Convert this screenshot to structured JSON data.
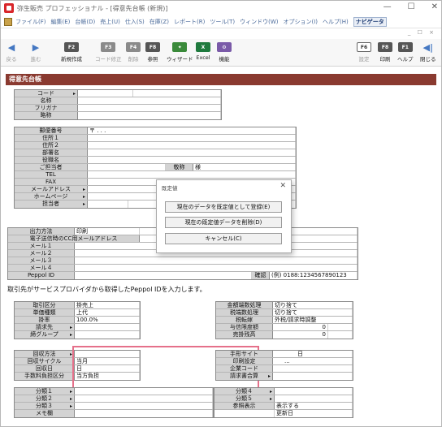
{
  "window": {
    "title": "弥生販売 プロフェッショナル - [得意先台帳 (新規)]",
    "controls": [
      "—",
      "☐",
      "✕"
    ]
  },
  "menu": {
    "items": [
      "ファイル(F)",
      "編集(E)",
      "台帳(D)",
      "売上(U)",
      "仕入(S)",
      "在庫(Z)",
      "レポート(R)",
      "ツール(T)",
      "ウィンドウ(W)",
      "オプション(I)",
      "ヘルプ(H)"
    ],
    "navi": "ナビゲータ",
    "mdi_controls": "_ ☐ ×"
  },
  "toolbar": {
    "buttons": [
      {
        "key": "◀",
        "label": "戻る"
      },
      {
        "key": "▶",
        "label": "進む"
      },
      {
        "key": "F2",
        "label": "新規作成"
      },
      {
        "key": "F3",
        "label": "コード修正"
      },
      {
        "key": "F4",
        "label": "削除"
      },
      {
        "key": "F8",
        "label": "参照"
      },
      {
        "key": "✦",
        "label": "ウィザード"
      },
      {
        "key": "X",
        "label": "Excel"
      },
      {
        "key": "⚙",
        "label": "機能"
      }
    ],
    "right_buttons": [
      {
        "key": "F6",
        "label": "設定"
      },
      {
        "key": "F8",
        "label": "印刷"
      },
      {
        "key": "F1",
        "label": "ヘルプ"
      },
      {
        "key": "◀|",
        "label": "閉じる"
      }
    ]
  },
  "form": {
    "header": "得意先台帳",
    "basic": {
      "code": "コード",
      "name": "名称",
      "furigana": "フリガナ",
      "short_name": "略称"
    },
    "address": {
      "postal_label": "郵便番号",
      "postal_value": "〒 . . .",
      "addr1": "住所１",
      "addr2": "住所２",
      "dept": "部署名",
      "title": "役職名",
      "contact": "ご担当者",
      "honorific_label": "敬称",
      "honorific_value": "様",
      "tel": "TEL",
      "fax": "FAX",
      "mail": "メールアドレス",
      "homepage": "ホームページ",
      "staff": "担当者"
    },
    "output": {
      "method_label": "出力方法",
      "method_value": "印刷",
      "cc_mail": "電子送信時のCC用メールアドレス",
      "mail1": "メール１",
      "mail2": "メール２",
      "mail3": "メール３",
      "mail4": "メール４",
      "peppol_label": "Peppol ID",
      "peppol_confirm": "確認",
      "peppol_example": "(例) 0188:1234567890123"
    },
    "note": "取引先がサービスプロバイダから取得したPeppol IDを入力します。",
    "trade": {
      "left": [
        {
          "label": "取引区分",
          "value": "掛売上"
        },
        {
          "label": "単価種類",
          "value": "上代"
        },
        {
          "label": "掛率",
          "value": "100.0%"
        },
        {
          "label": "請求先",
          "value": ""
        },
        {
          "label": "締グループ",
          "value": ""
        }
      ],
      "right": [
        {
          "label": "金額端数処理",
          "value": "切り捨て"
        },
        {
          "label": "税端数処理",
          "value": "切り捨て"
        },
        {
          "label": "税転嫁",
          "value": "外税/請求時調整"
        },
        {
          "label": "与信限度額",
          "value": "0"
        },
        {
          "label": "売掛残高",
          "value": "0"
        }
      ]
    },
    "collection": {
      "left": [
        {
          "label": "回収方法",
          "value": ""
        },
        {
          "label": "回収サイクル",
          "value": "当月"
        },
        {
          "label": "回収日",
          "value": "日"
        },
        {
          "label": "手数料負担区分",
          "value": "当方負担"
        }
      ],
      "right": [
        {
          "label": "手形サイト",
          "value": "日"
        },
        {
          "label": "印刷設定",
          "value": "..."
        },
        {
          "label": "企業コード",
          "value": ""
        },
        {
          "label": "請求書合算",
          "value": ""
        }
      ]
    },
    "classification": {
      "left": [
        "分類１",
        "分類２",
        "分類３",
        "メモ欄"
      ],
      "right": [
        "分類４",
        "分類５",
        "参照表示"
      ],
      "ref_value": "表示する",
      "updated": "更新日"
    }
  },
  "dialog": {
    "title": "既定値",
    "close": "✕",
    "buttons": [
      "現在のデータを既定値として登録(E)",
      "現在の既定値データを削除(D)",
      "キャンセル(C)"
    ]
  },
  "colors": {
    "header": "#8a3a30",
    "label_bg": "#d3d3d3",
    "highlight": "#e5708a"
  }
}
